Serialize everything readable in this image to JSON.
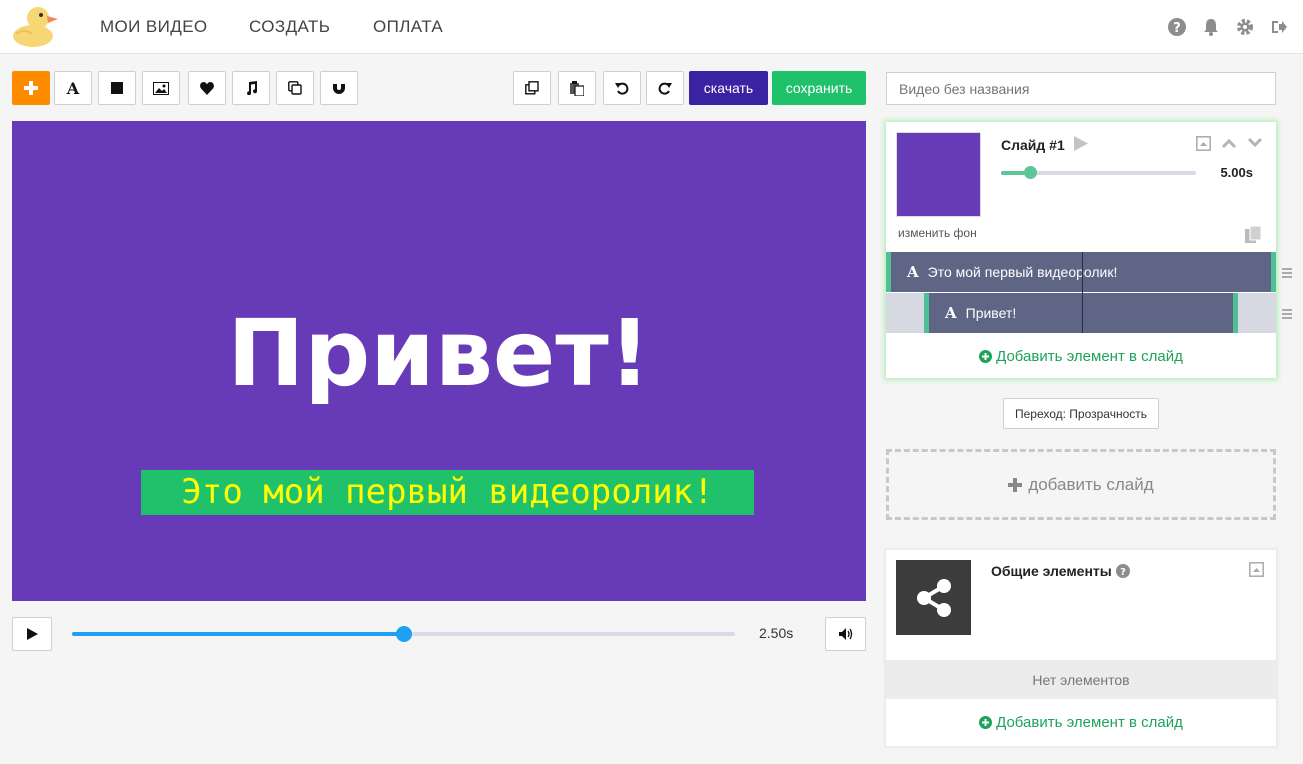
{
  "nav": {
    "items": [
      "МОИ ВИДЕО",
      "СОЗДАТЬ",
      "ОПЛАТА"
    ]
  },
  "toolbar": {
    "download_label": "скачать",
    "save_label": "сохранить"
  },
  "canvas": {
    "background_color": "#673ab7",
    "title_text": "Привет!",
    "subtitle_text": "Это мой первый видеоролик!",
    "subtitle_background": "#1fc16b",
    "subtitle_color": "#ffff00"
  },
  "player": {
    "current_time": "2.50s",
    "progress_fraction": 0.5
  },
  "project": {
    "title_placeholder": "Видео без названия"
  },
  "slide": {
    "name": "Слайд #1",
    "duration": "5.00s",
    "duration_fraction": 0.15,
    "change_bg_label": "изменить фон",
    "layers": [
      "Это мой первый видеоролик!",
      "Привет!"
    ],
    "add_element_label": "Добавить элемент в слайд"
  },
  "transition": {
    "label": "Переход: Прозрачность"
  },
  "add_slide_label": "добавить слайд",
  "common": {
    "title": "Общие элементы",
    "empty_label": "Нет элементов",
    "add_element_label": "Добавить элемент в слайд"
  },
  "colors": {
    "accent_orange": "#ff8c00",
    "download_purple": "#3a23a0",
    "save_green": "#1fc16b",
    "progress_blue": "#1da1f2",
    "layer_handle_green": "#4fbf95"
  }
}
